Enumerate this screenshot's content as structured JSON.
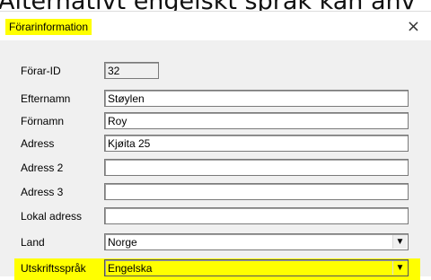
{
  "background_text": "Alternativt engelskt språk kan anv",
  "dialog": {
    "title": "Förarinformation",
    "close_glyph": "×",
    "highlight_color": "#ffff00",
    "fields": [
      {
        "label": "Förar-ID",
        "value": "32"
      },
      {
        "label": "Efternamn",
        "value": "Støylen"
      },
      {
        "label": "Förnamn",
        "value": "Roy"
      },
      {
        "label": "Adress",
        "value": "Kjøita 25"
      },
      {
        "label": "Adress 2",
        "value": ""
      },
      {
        "label": "Adress 3",
        "value": ""
      },
      {
        "label": "Lokal adress",
        "value": ""
      },
      {
        "label": "Land",
        "value": "Norge",
        "arrow": "chevron-down-icon"
      },
      {
        "label": "Utskriftsspråk",
        "value": "Engelska",
        "arrow": "chevron-down-icon"
      }
    ]
  }
}
